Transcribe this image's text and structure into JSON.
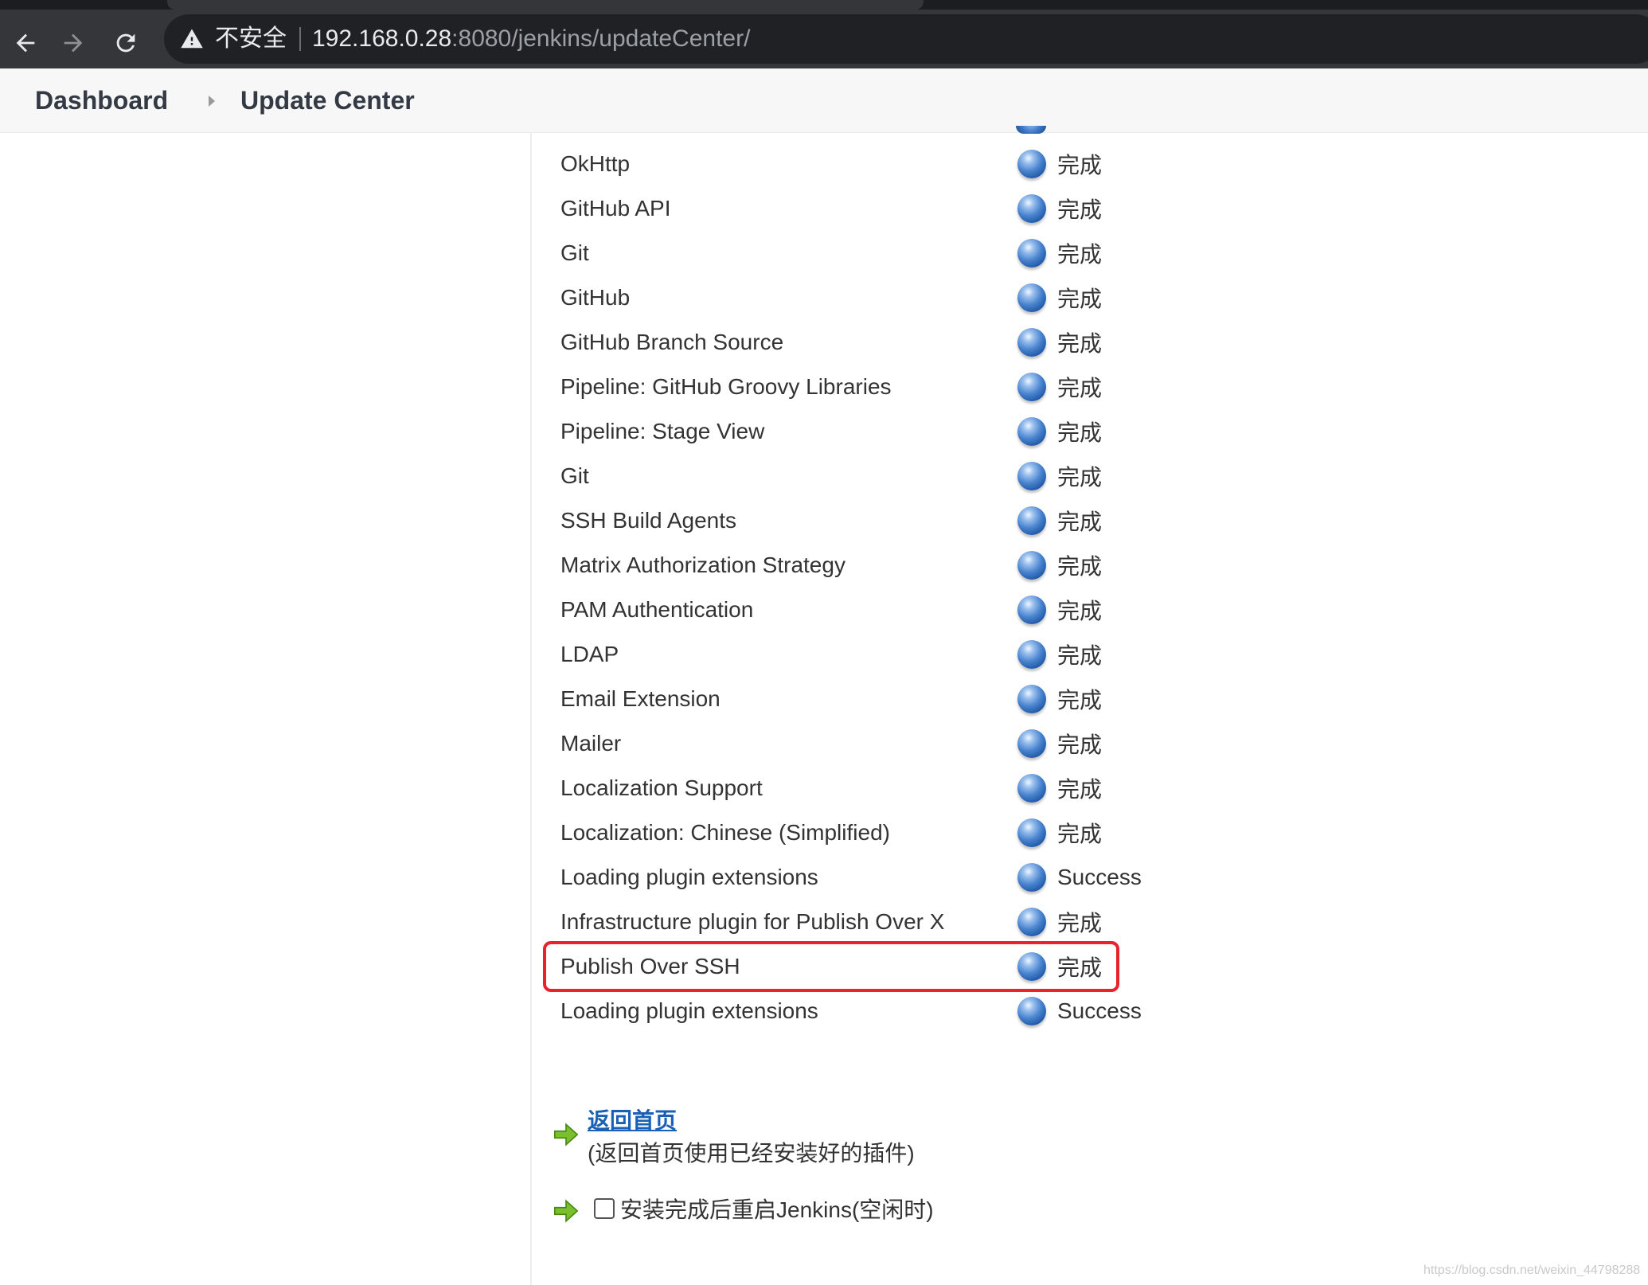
{
  "browser": {
    "security_label": "不安全",
    "url_host": "192.168.0.28",
    "url_rest": ":8080/jenkins/updateCenter/"
  },
  "breadcrumb": {
    "items": [
      "Dashboard",
      "Update Center"
    ]
  },
  "plugins": [
    {
      "name": "OkHttp",
      "status": "完成"
    },
    {
      "name": "GitHub API",
      "status": "完成"
    },
    {
      "name": "Git",
      "status": "完成"
    },
    {
      "name": "GitHub",
      "status": "完成"
    },
    {
      "name": "GitHub Branch Source",
      "status": "完成"
    },
    {
      "name": "Pipeline: GitHub Groovy Libraries",
      "status": "完成"
    },
    {
      "name": "Pipeline: Stage View",
      "status": "完成"
    },
    {
      "name": "Git",
      "status": "完成"
    },
    {
      "name": "SSH Build Agents",
      "status": "完成"
    },
    {
      "name": "Matrix Authorization Strategy",
      "status": "完成"
    },
    {
      "name": "PAM Authentication",
      "status": "完成"
    },
    {
      "name": "LDAP",
      "status": "完成"
    },
    {
      "name": "Email Extension",
      "status": "完成"
    },
    {
      "name": "Mailer",
      "status": "完成"
    },
    {
      "name": "Localization Support",
      "status": "完成"
    },
    {
      "name": "Localization: Chinese (Simplified)",
      "status": "完成"
    },
    {
      "name": "Loading plugin extensions",
      "status": "Success"
    },
    {
      "name": "Infrastructure plugin for Publish Over X",
      "status": "完成"
    },
    {
      "name": "Publish Over SSH",
      "status": "完成"
    },
    {
      "name": "Loading plugin extensions",
      "status": "Success"
    }
  ],
  "actions": {
    "home_link": "返回首页",
    "home_description": "(返回首页使用已经安装好的插件)",
    "restart_label": "安装完成后重启Jenkins(空闲时)",
    "restart_checked": false
  },
  "watermark": "https://blog.csdn.net/weixin_44798288",
  "colors": {
    "highlight": "#e8242a",
    "link": "#1a60b5",
    "status_ball": "#2f6cc0"
  }
}
